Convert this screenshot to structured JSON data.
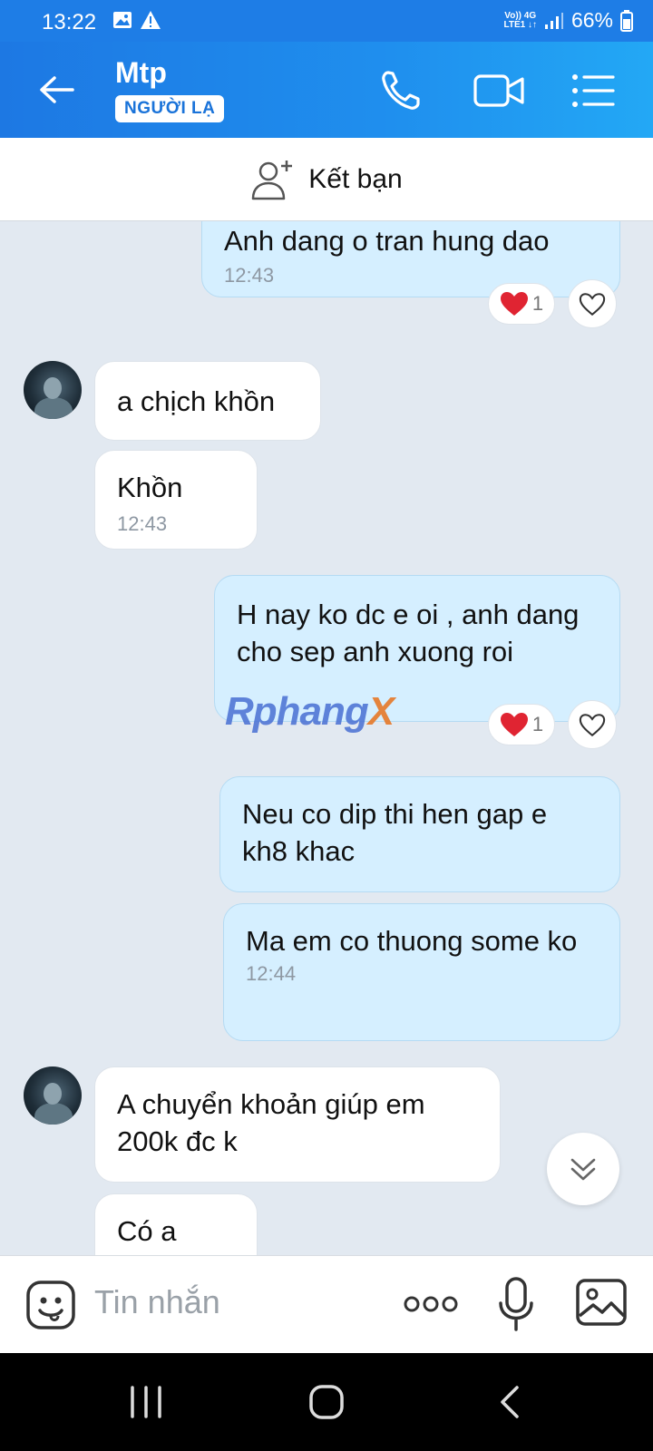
{
  "status_bar": {
    "time": "13:22",
    "network_top": "Vo)) 4G",
    "network_bottom": "LTE1 ↓↑",
    "battery": "66%"
  },
  "header": {
    "contact_name": "Mtp",
    "badge": "NGƯỜI LẠ",
    "icons": [
      "back-arrow-icon",
      "phone-icon",
      "video-icon",
      "menu-icon"
    ]
  },
  "friend_bar": {
    "label": "Kết bạn",
    "icon": "add-friend-icon"
  },
  "messages": [
    {
      "side": "me",
      "text": "Anh dang o tran hung dao",
      "time": "12:43",
      "reaction_count": "1"
    },
    {
      "side": "them",
      "text": "a chịch khồn"
    },
    {
      "side": "them",
      "text": "Khồn",
      "time": "12:43"
    },
    {
      "side": "me",
      "text": "H nay ko dc e oi , anh dang cho sep anh xuong roi",
      "reaction_count": "1"
    },
    {
      "side": "me",
      "text": "Neu co dip thi hen gap e kh8 khac"
    },
    {
      "side": "me",
      "text": "Ma em co thuong some ko",
      "time": "12:44"
    },
    {
      "side": "them",
      "text": "A chuyển khoản giúp em 200k đc k"
    },
    {
      "side": "them",
      "text": "Có a"
    }
  ],
  "watermark": {
    "main": "Rphang",
    "accent": "X"
  },
  "input_bar": {
    "placeholder": "Tin nhắn"
  },
  "colors": {
    "header": "#1d78e3",
    "my_bubble": "#d5efff",
    "their_bubble": "#ffffff",
    "chat_bg": "#e2e9f1"
  }
}
